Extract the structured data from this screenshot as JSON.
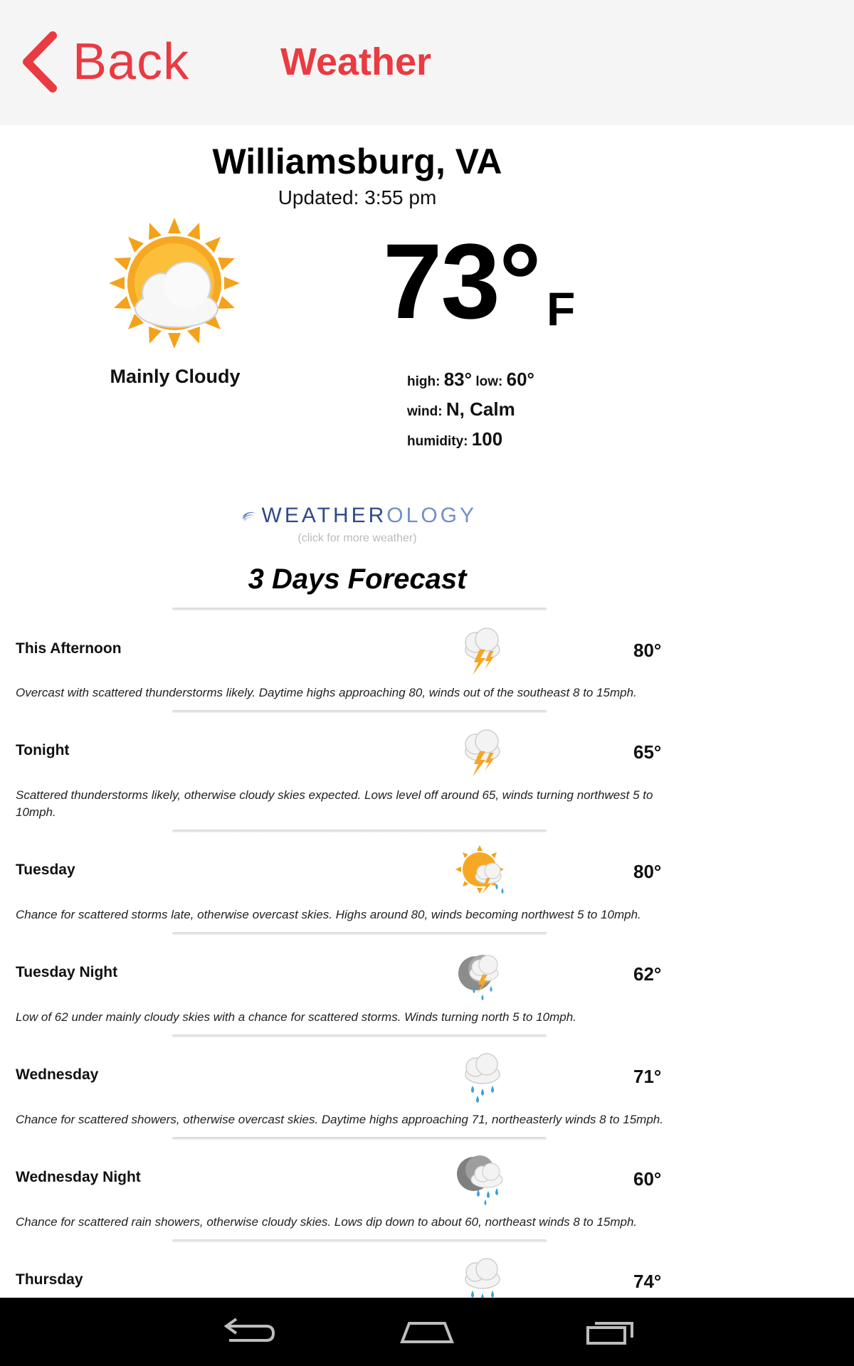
{
  "header": {
    "back_label": "Back",
    "title": "Weather"
  },
  "location": {
    "city": "Williamsburg, VA",
    "updated": "Updated: 3:55 pm"
  },
  "current": {
    "condition": "Mainly Cloudy",
    "temperature": "73°",
    "unit": "F",
    "high_label": "high:",
    "high": "83°",
    "low_label": "low:",
    "low": "60°",
    "wind_label": "wind:",
    "wind": "N, Calm",
    "humidity_label": "humidity:",
    "humidity": "100"
  },
  "logo": {
    "brand_dark": "WEATHER",
    "brand_light": "OLOGY",
    "caption": "(click for more weather)"
  },
  "forecast": {
    "title": "3 Days Forecast",
    "periods": [
      {
        "name": "This Afternoon",
        "temp": "80°",
        "icon": "thunderstorm-icon",
        "desc": "Overcast with scattered thunderstorms likely. Daytime highs approaching 80, winds out of the southeast 8 to 15mph."
      },
      {
        "name": "Tonight",
        "temp": "65°",
        "icon": "thunderstorm-icon",
        "desc": "Scattered thunderstorms likely, otherwise cloudy skies expected. Lows level off around 65, winds turning northwest 5 to 10mph."
      },
      {
        "name": "Tuesday",
        "temp": "80°",
        "icon": "sun-storm-icon",
        "desc": "Chance for scattered storms late, otherwise overcast skies. Highs around 80, winds becoming northwest 5 to 10mph."
      },
      {
        "name": "Tuesday Night",
        "temp": "62°",
        "icon": "moon-storm-icon",
        "desc": "Low of 62 under mainly cloudy skies with a chance for scattered storms. Winds turning north 5 to 10mph."
      },
      {
        "name": "Wednesday",
        "temp": "71°",
        "icon": "showers-icon",
        "desc": "Chance for scattered showers, otherwise overcast skies. Daytime highs approaching 71, northeasterly winds 8 to 15mph."
      },
      {
        "name": "Wednesday Night",
        "temp": "60°",
        "icon": "moon-rain-icon",
        "desc": "Chance for scattered rain showers, otherwise cloudy skies. Lows dip down to about 60, northeast winds 8 to 15mph."
      },
      {
        "name": "Thursday",
        "temp": "74°",
        "icon": "showers-icon",
        "desc": ""
      }
    ]
  },
  "colors": {
    "accent": "#ea3a42"
  }
}
